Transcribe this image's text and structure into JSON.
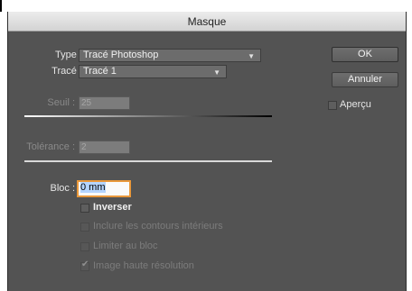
{
  "window": {
    "title": "Masque"
  },
  "type_row": {
    "label": "Type :",
    "value": "Tracé Photoshop"
  },
  "path_row": {
    "label": "Tracé :",
    "value": "Tracé 1"
  },
  "threshold_row": {
    "label": "Seuil :",
    "value": "25"
  },
  "tolerance_row": {
    "label": "Tolérance :",
    "value": "2"
  },
  "inset_row": {
    "label": "Bloc :",
    "value": "0 mm"
  },
  "options": {
    "invert": {
      "label": "Inverser",
      "checked": false,
      "enabled": true
    },
    "include_inside_edges": {
      "label": "Inclure les contours intérieurs",
      "checked": false,
      "enabled": false
    },
    "restrict_to_frame": {
      "label": "Limiter au bloc",
      "checked": false,
      "enabled": false
    },
    "high_res_image": {
      "label": "Image haute résolution",
      "checked": true,
      "enabled": false
    }
  },
  "buttons": {
    "ok": "OK",
    "cancel": "Annuler",
    "preview": "Aperçu"
  },
  "icons": {
    "dropdown": "chevron-down-icon",
    "check": "checkmark-icon"
  },
  "colors": {
    "dialog_bg": "#535353",
    "focus_ring": "#e9983b",
    "selection": "#b5d5ff"
  }
}
